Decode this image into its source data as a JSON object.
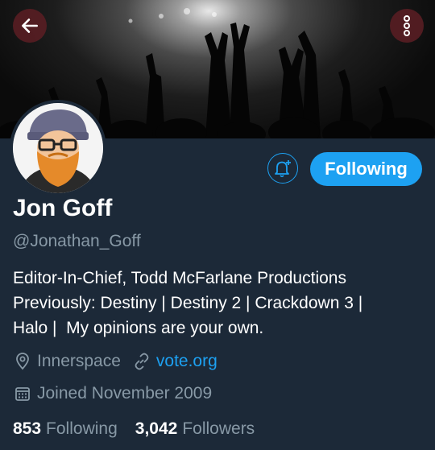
{
  "header": {
    "back_icon": "arrow-left-icon",
    "menu_icon": "more-vertical-icon"
  },
  "profile": {
    "name": "Jon Goff",
    "handle": "@Jonathan_Goff",
    "bio_lines": [
      "Editor-In-Chief, Todd McFarlane Productions",
      "Previously: Destiny | Destiny 2 | Crackdown 3 |",
      "Halo |  My opinions are your own."
    ],
    "location": "Innerspace",
    "website": "vote.org",
    "joined": "Joined November 2009"
  },
  "actions": {
    "notify_icon": "bell-plus-icon",
    "follow_label": "Following"
  },
  "stats": {
    "following_count": "853",
    "following_label": "Following",
    "followers_count": "3,042",
    "followers_label": "Followers"
  },
  "colors": {
    "background": "#1c2938",
    "accent": "#1da1f2",
    "secondary_text": "#8899a6",
    "overlay_button": "#5a1e23"
  }
}
